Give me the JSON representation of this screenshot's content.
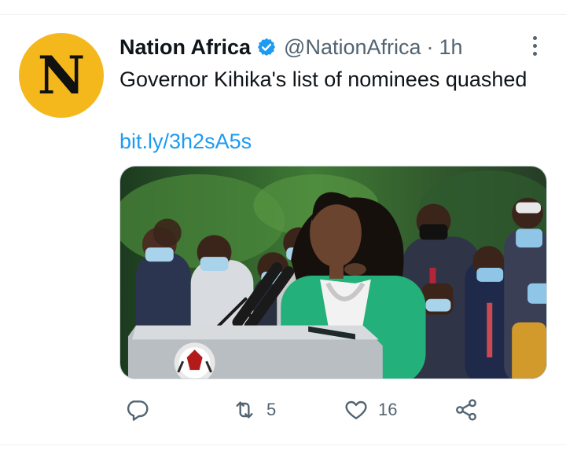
{
  "tweet": {
    "avatar_letter": "N",
    "display_name": "Nation Africa",
    "handle": "@NationAfrica",
    "separator": "·",
    "time": "1h",
    "text": "Governor Kihika's list of nominees quashed",
    "link": "bit.ly/3h2sA5s",
    "verified_icon": "verified-badge-icon",
    "image_description_icon": "photo"
  },
  "actions": {
    "reply_count": "",
    "retweet_count": "5",
    "like_count": "16",
    "share_count": ""
  },
  "colors": {
    "accent": "#1d9bf0",
    "avatar_bg": "#f5b81c",
    "muted_text": "#536471",
    "jacket": "#23b07a"
  }
}
